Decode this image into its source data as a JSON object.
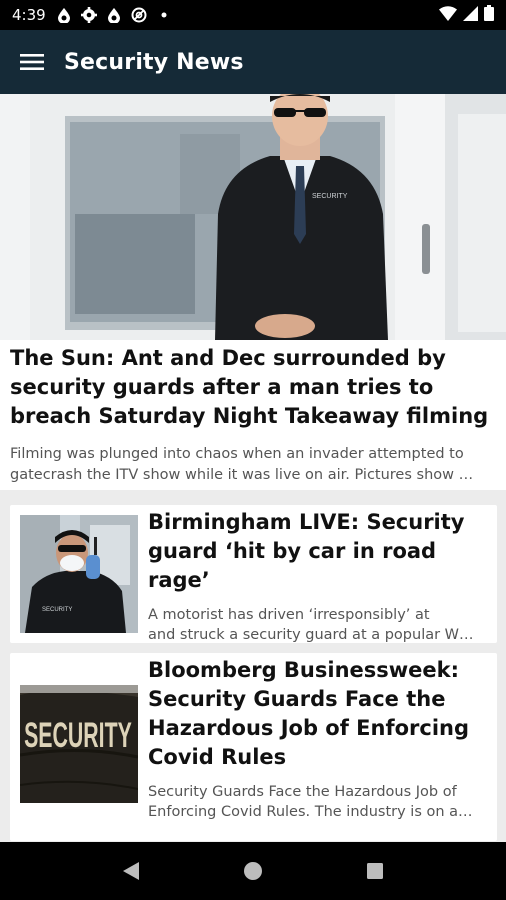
{
  "status_bar": {
    "time": "4:39",
    "icons": [
      "drop-icon",
      "gear-icon",
      "drop-icon",
      "at-sign-icon",
      "dot-icon"
    ],
    "right_icons": [
      "wifi-icon",
      "signal-icon",
      "battery-icon"
    ]
  },
  "app_bar": {
    "title": "Security News",
    "menu_icon": "hamburger-menu-icon",
    "background": "#152a37"
  },
  "featured_article": {
    "title": "The Sun:  Ant and Dec surrounded by security guards after a man tries to breach Saturday Night Takeaway filming",
    "summary": "Filming was plunged into chaos when an invader attempted to gatecrash the ITV show while it was live on air. Pictures show …",
    "image": "security-guard-in-doorway-photo"
  },
  "articles": [
    {
      "title": "Birmingham LIVE:  Security guard ‘hit by car in road rage’",
      "summary_line1": "A motorist has driven ‘irresponsibly’ at",
      "summary_line2": "and struck a security guard at a popular W…",
      "image": "masked-security-guard-photo"
    },
    {
      "title": "Bloomberg Businessweek:  Security Guards Face the Hazardous Job of Enforcing Covid Rules",
      "summary_line1": "Security Guards Face the Hazardous Job of",
      "summary_line2": "Enforcing Covid Rules. The industry is on a…",
      "image": "security-jacket-back-photo",
      "image_text": "SECURITY"
    }
  ],
  "nav_bar": {
    "back_icon": "back-triangle-icon",
    "home_icon": "home-circle-icon",
    "recents_icon": "recents-square-icon"
  }
}
